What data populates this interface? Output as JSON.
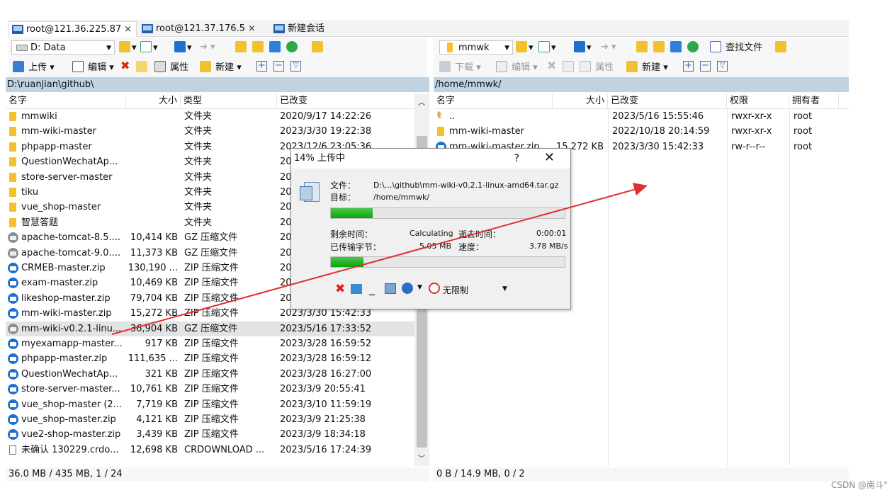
{
  "tabs": [
    {
      "label": "root@121.36.225.87",
      "close": "×"
    },
    {
      "label": "root@121.37.176.5",
      "close": "×"
    },
    {
      "label": "新建会话"
    }
  ],
  "left": {
    "drive": "D: Data",
    "toolbar": {
      "upload": "上传",
      "edit": "编辑",
      "properties": "属性",
      "new": "新建"
    },
    "path": "D:\\ruanjian\\github\\",
    "columns": {
      "name": "名字",
      "size": "大小",
      "type": "类型",
      "modified": "已改变"
    },
    "files": [
      {
        "name": "mmwiki",
        "size": "",
        "type": "文件夹",
        "modified": "2020/9/17  14:22:26",
        "icon": "folder"
      },
      {
        "name": "mm-wiki-master",
        "size": "",
        "type": "文件夹",
        "modified": "2023/3/30  19:22:38",
        "icon": "folder"
      },
      {
        "name": "phpapp-master",
        "size": "",
        "type": "文件夹",
        "modified": "2023/12/6  23:05:36",
        "icon": "folder"
      },
      {
        "name": "QuestionWechatAp...",
        "size": "",
        "type": "文件夹",
        "modified": "20",
        "icon": "folder"
      },
      {
        "name": "store-server-master",
        "size": "",
        "type": "文件夹",
        "modified": "20",
        "icon": "folder"
      },
      {
        "name": "tiku",
        "size": "",
        "type": "文件夹",
        "modified": "20",
        "icon": "folder"
      },
      {
        "name": "vue_shop-master",
        "size": "",
        "type": "文件夹",
        "modified": "20",
        "icon": "folder"
      },
      {
        "name": "智慧答题",
        "size": "",
        "type": "文件夹",
        "modified": "20",
        "icon": "folder"
      },
      {
        "name": "apache-tomcat-8.5....",
        "size": "10,414 KB",
        "type": "GZ 压缩文件",
        "modified": "20",
        "icon": "gz"
      },
      {
        "name": "apache-tomcat-9.0....",
        "size": "11,373 KB",
        "type": "GZ 压缩文件",
        "modified": "20",
        "icon": "gz"
      },
      {
        "name": "CRMEB-master.zip",
        "size": "130,190 ...",
        "type": "ZIP 压缩文件",
        "modified": "20",
        "icon": "zip"
      },
      {
        "name": "exam-master.zip",
        "size": "10,469 KB",
        "type": "ZIP 压缩文件",
        "modified": "20",
        "icon": "zip"
      },
      {
        "name": "likeshop-master.zip",
        "size": "79,704 KB",
        "type": "ZIP 压缩文件",
        "modified": "20",
        "icon": "zip"
      },
      {
        "name": "mm-wiki-master.zip",
        "size": "15,272 KB",
        "type": "ZIP 压缩文件",
        "modified": "2023/3/30  15:42:33",
        "icon": "zip"
      },
      {
        "name": "mm-wiki-v0.2.1-linu...",
        "size": "36,904 KB",
        "type": "GZ 压缩文件",
        "modified": "2023/5/16  17:33:52",
        "icon": "gz",
        "selected": true
      },
      {
        "name": "myexamapp-master...",
        "size": "917 KB",
        "type": "ZIP 压缩文件",
        "modified": "2023/3/28  16:59:52",
        "icon": "zip"
      },
      {
        "name": "phpapp-master.zip",
        "size": "111,635 ...",
        "type": "ZIP 压缩文件",
        "modified": "2023/3/28  16:59:12",
        "icon": "zip"
      },
      {
        "name": "QuestionWechatAp...",
        "size": "321 KB",
        "type": "ZIP 压缩文件",
        "modified": "2023/3/28  16:27:00",
        "icon": "zip"
      },
      {
        "name": "store-server-master...",
        "size": "10,761 KB",
        "type": "ZIP 压缩文件",
        "modified": "2023/3/9  20:55:41",
        "icon": "zip"
      },
      {
        "name": "vue_shop-master (2...",
        "size": "7,719 KB",
        "type": "ZIP 压缩文件",
        "modified": "2023/3/10  11:59:19",
        "icon": "zip"
      },
      {
        "name": "vue_shop-master.zip",
        "size": "4,121 KB",
        "type": "ZIP 压缩文件",
        "modified": "2023/3/9  21:25:38",
        "icon": "zip"
      },
      {
        "name": "vue2-shop-master.zip",
        "size": "3,439 KB",
        "type": "ZIP 压缩文件",
        "modified": "2023/3/9  18:34:18",
        "icon": "zip"
      },
      {
        "name": "未确认 130229.crdo...",
        "size": "12,698 KB",
        "type": "CRDOWNLOAD ...",
        "modified": "2023/5/16  17:24:39",
        "icon": "file"
      }
    ],
    "status": "36.0 MB / 435 MB,  1 / 24"
  },
  "right": {
    "drive": "mmwk",
    "toolbar": {
      "download": "下载",
      "edit": "编辑",
      "properties": "属性",
      "new": "新建",
      "find": "查找文件"
    },
    "path": "/home/mmwk/",
    "columns": {
      "name": "名字",
      "size": "大小",
      "modified": "已改变",
      "permissions": "权限",
      "owner": "拥有者"
    },
    "files": [
      {
        "name": "..",
        "size": "",
        "modified": "2023/5/16  15:55:46",
        "permissions": "rwxr-xr-x",
        "owner": "root",
        "icon": "up"
      },
      {
        "name": "mm-wiki-master",
        "size": "",
        "modified": "2022/10/18  20:14:59",
        "permissions": "rwxr-xr-x",
        "owner": "root",
        "icon": "folder"
      },
      {
        "name": "mm-wiki-master.zip",
        "size": "15,272 KB",
        "modified": "2023/3/30  15:42:33",
        "permissions": "rw-r--r--",
        "owner": "root",
        "icon": "zip"
      }
    ],
    "status": "0 B / 14.9 MB,  0 / 2"
  },
  "dialog": {
    "title": "14% 上传中",
    "help": "?",
    "close": "✕",
    "file_label": "文件：",
    "file_value": "D:\\...\\github\\mm-wiki-v0.2.1-linux-amd64.tar.gz",
    "target_label": "目标：",
    "target_value": "/home/mmwk/",
    "remaining_label": "剩余时间：",
    "remaining_value": "Calculating",
    "elapsed_label": "逝去时间：",
    "elapsed_value": "0:00:01",
    "transferred_label": "已传输字节：",
    "transferred_value": "5.05 MB",
    "speed_label": "速度：",
    "speed_value": "3.78 MB/s",
    "progress_file": 0.18,
    "progress_total": 0.14,
    "speed_limit": "无限制"
  },
  "watermark": "CSDN @南斗°",
  "colors": {
    "accent": "#1e6fd0",
    "progress": "#09a409",
    "arrow": "#e03030",
    "pathbar": "#bfd3e3",
    "folder": "#f2c12e"
  }
}
